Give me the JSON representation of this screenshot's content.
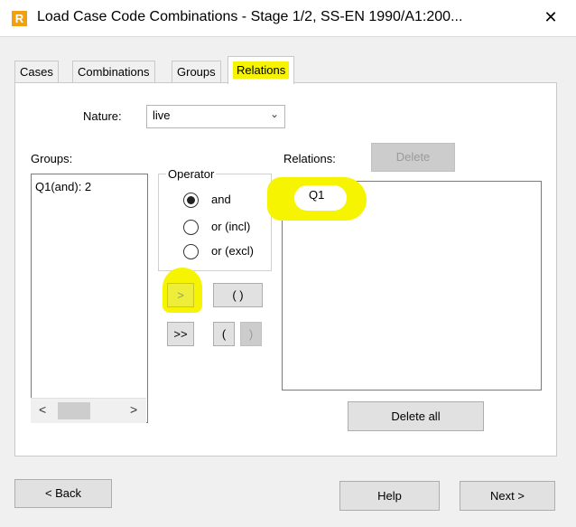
{
  "window": {
    "app_icon": "R",
    "title": "Load Case Code Combinations - Stage 1/2, SS-EN 1990/A1:200...",
    "close_icon": "✕"
  },
  "tabs": [
    {
      "label": "Cases"
    },
    {
      "label": "Combinations"
    },
    {
      "label": "Groups"
    },
    {
      "label": "Relations"
    }
  ],
  "nature": {
    "label": "Nature:",
    "value": "live"
  },
  "groups": {
    "label": "Groups:",
    "items": [
      "Q1(and): 2"
    ]
  },
  "operator": {
    "label": "Operator",
    "options": [
      {
        "label": "and",
        "checked": true
      },
      {
        "label": "or (incl)",
        "checked": false
      },
      {
        "label": "or (excl)",
        "checked": false
      }
    ]
  },
  "buttons": {
    "add": ">",
    "add_all": ">>",
    "paren_pair": "( )",
    "paren_open": "(",
    "paren_close": ")",
    "delete": "Delete",
    "delete_all": "Delete all",
    "back": "< Back",
    "help": "Help",
    "next": "Next >"
  },
  "relations": {
    "label": "Relations:",
    "items": [
      "Q1"
    ]
  },
  "scrollbar": {
    "left_arrow": "<",
    "right_arrow": ">"
  },
  "highlight_color": "#f6f400"
}
